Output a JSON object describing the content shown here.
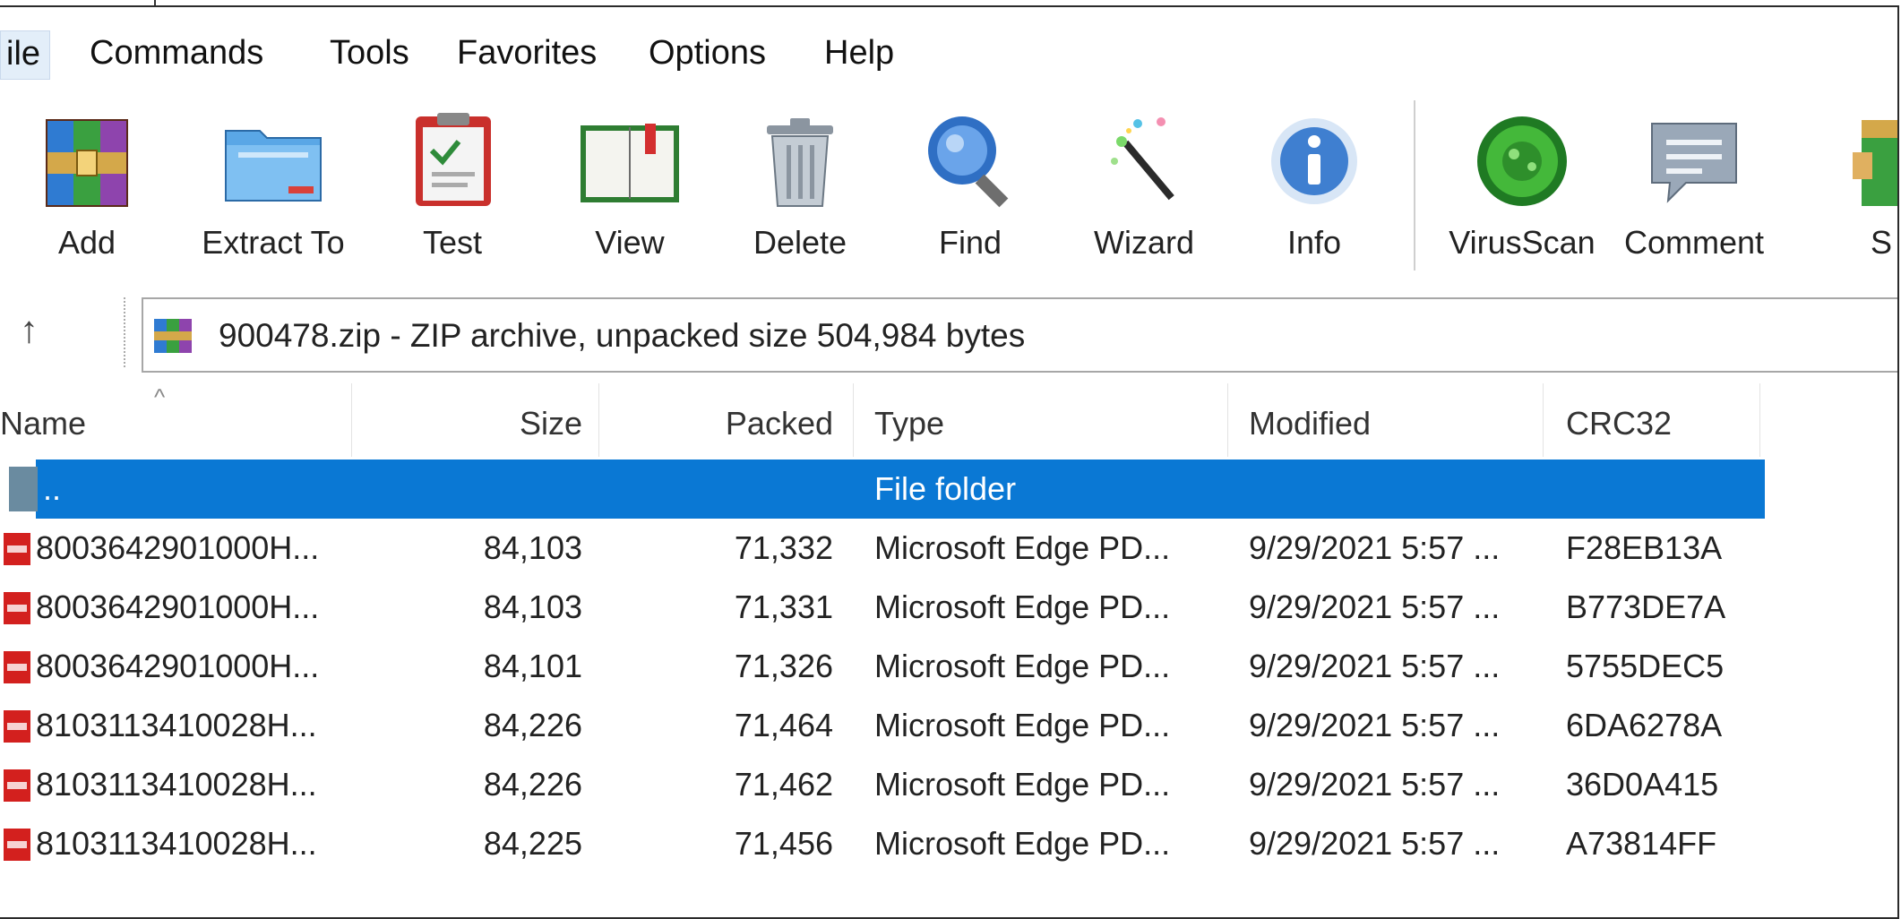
{
  "menu": [
    "ile",
    "Commands",
    "Tools",
    "Favorites",
    "Options",
    "Help"
  ],
  "toolbar": [
    {
      "label": "Add",
      "icon": "add-archive-icon"
    },
    {
      "label": "Extract To",
      "icon": "extract-folder-icon"
    },
    {
      "label": "Test",
      "icon": "test-clipboard-icon"
    },
    {
      "label": "View",
      "icon": "view-book-icon"
    },
    {
      "label": "Delete",
      "icon": "delete-trash-icon"
    },
    {
      "label": "Find",
      "icon": "find-magnifier-icon"
    },
    {
      "label": "Wizard",
      "icon": "wizard-wand-icon"
    },
    {
      "label": "Info",
      "icon": "info-icon"
    },
    {
      "label": "VirusScan",
      "icon": "virusscan-icon"
    },
    {
      "label": "Comment",
      "icon": "comment-icon"
    },
    {
      "label": "S",
      "icon": "sfx-icon"
    }
  ],
  "address": {
    "text": "900478.zip - ZIP archive, unpacked size 504,984 bytes"
  },
  "columns": {
    "name": "Name",
    "size": "Size",
    "packed": "Packed",
    "type": "Type",
    "modified": "Modified",
    "crc": "CRC32"
  },
  "parent_row": {
    "name": "..",
    "type": "File folder"
  },
  "files": [
    {
      "name": "8003642901000H...",
      "size": "84,103",
      "packed": "71,332",
      "type": "Microsoft Edge PD...",
      "modified": "9/29/2021 5:57 ...",
      "crc": "F28EB13A"
    },
    {
      "name": "8003642901000H...",
      "size": "84,103",
      "packed": "71,331",
      "type": "Microsoft Edge PD...",
      "modified": "9/29/2021 5:57 ...",
      "crc": "B773DE7A"
    },
    {
      "name": "8003642901000H...",
      "size": "84,101",
      "packed": "71,326",
      "type": "Microsoft Edge PD...",
      "modified": "9/29/2021 5:57 ...",
      "crc": "5755DEC5"
    },
    {
      "name": "8103113410028H...",
      "size": "84,226",
      "packed": "71,464",
      "type": "Microsoft Edge PD...",
      "modified": "9/29/2021 5:57 ...",
      "crc": "6DA6278A"
    },
    {
      "name": "8103113410028H...",
      "size": "84,226",
      "packed": "71,462",
      "type": "Microsoft Edge PD...",
      "modified": "9/29/2021 5:57 ...",
      "crc": "36D0A415"
    },
    {
      "name": "8103113410028H...",
      "size": "84,225",
      "packed": "71,456",
      "type": "Microsoft Edge PD...",
      "modified": "9/29/2021 5:57 ...",
      "crc": "A73814FF"
    }
  ],
  "colors": {
    "selection": "#0a78d4",
    "pdf_red": "#d3201e"
  }
}
